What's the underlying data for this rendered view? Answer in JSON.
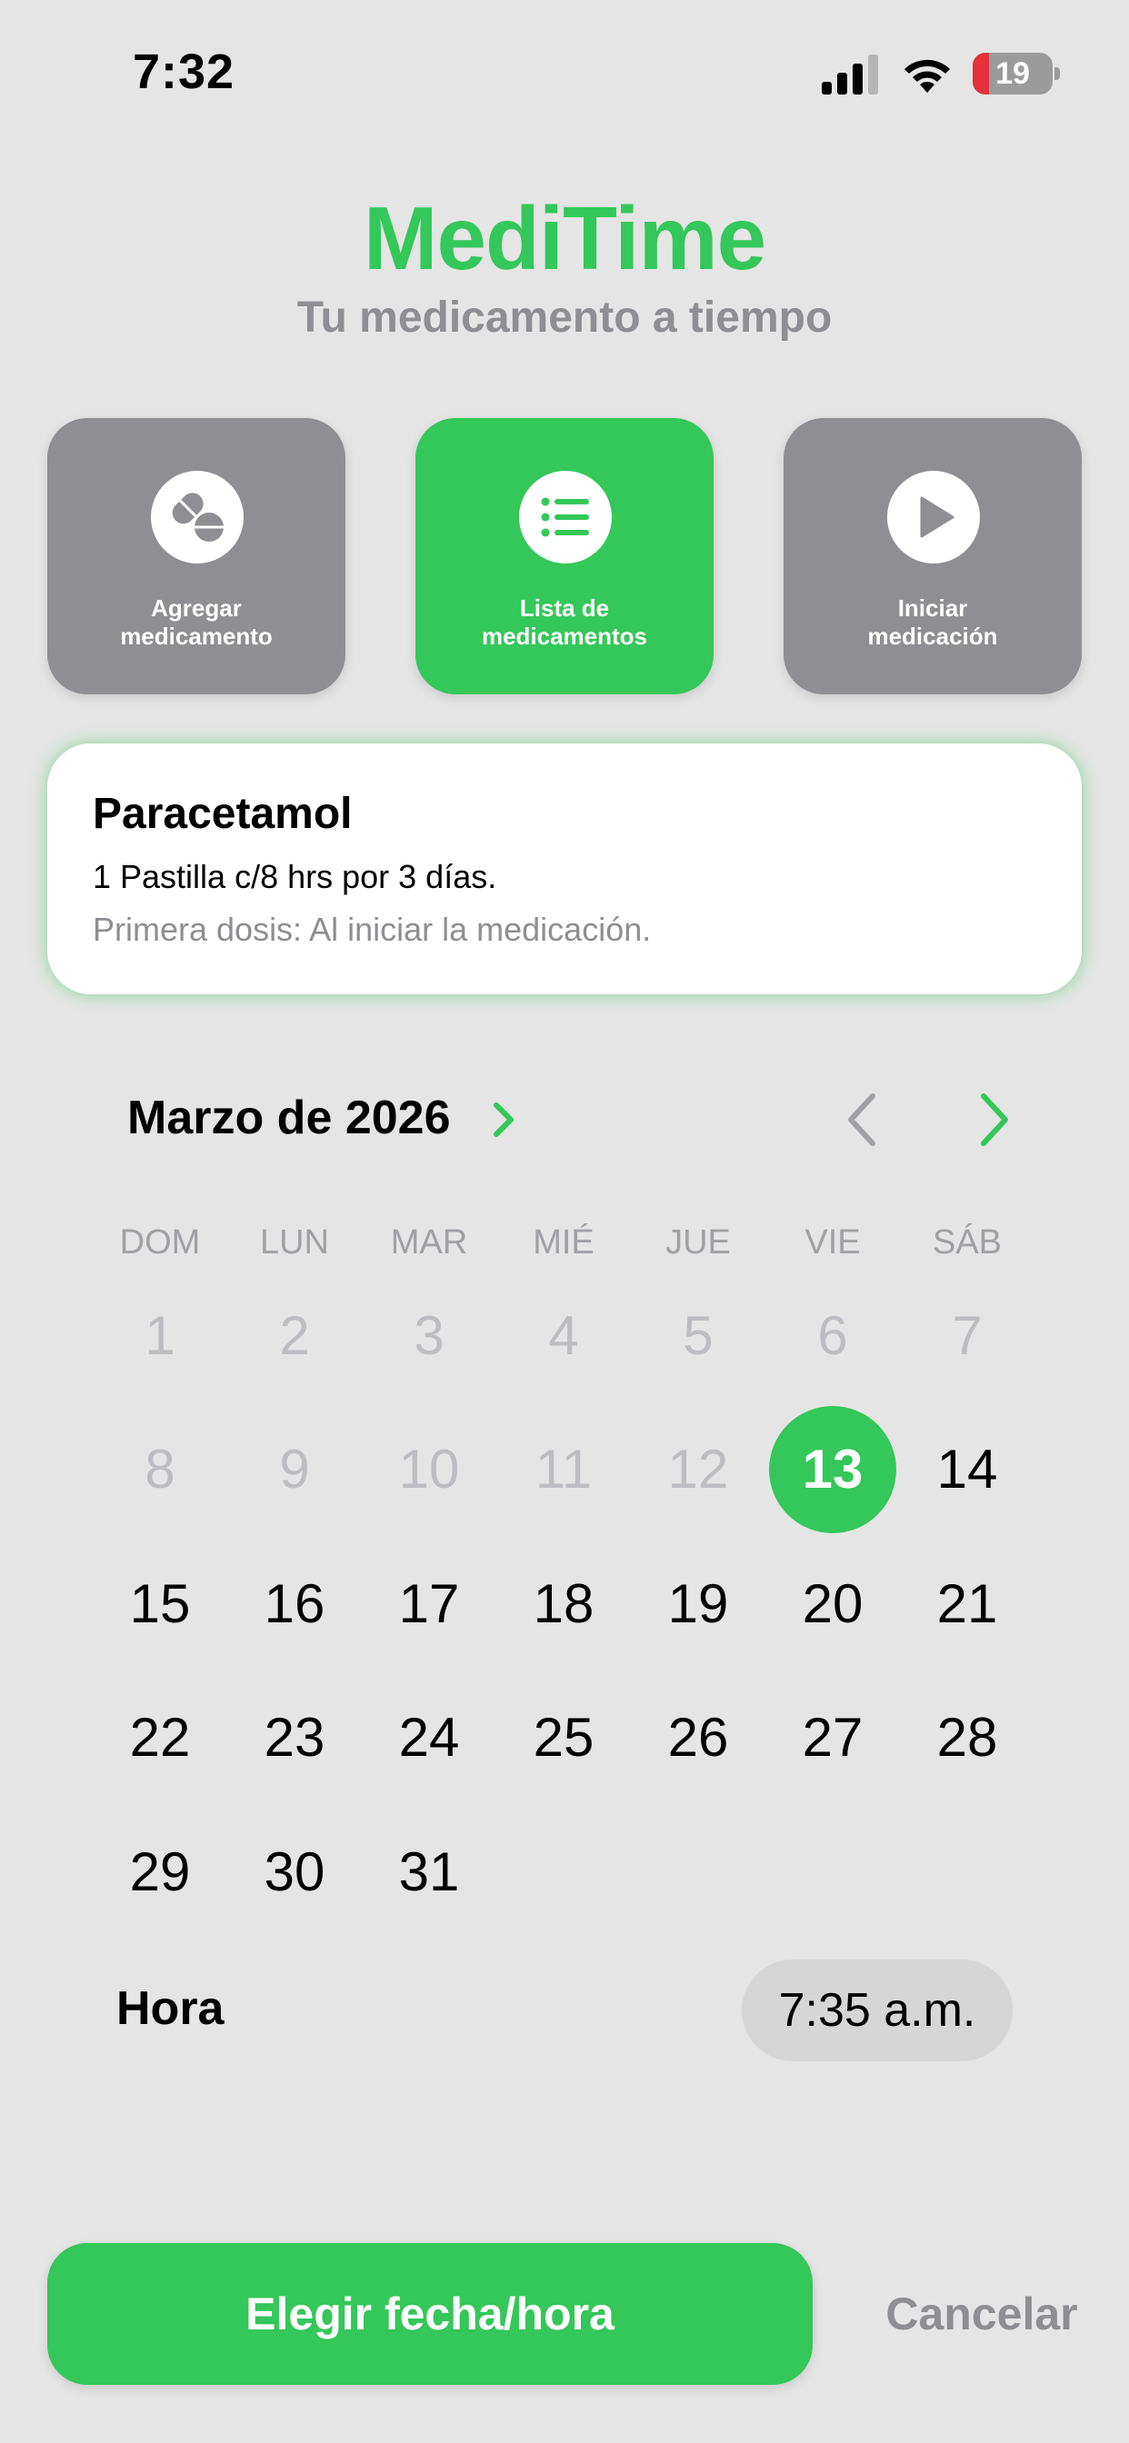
{
  "status": {
    "time": "7:32",
    "battery": "19"
  },
  "header": {
    "title": "MediTime",
    "subtitle": "Tu medicamento a tiempo"
  },
  "tiles": [
    {
      "label": "Agregar\nmedicamento",
      "icon": "pills-icon"
    },
    {
      "label": "Lista de\nmedicamentos",
      "icon": "list-icon"
    },
    {
      "label": "Iniciar\nmedicación",
      "icon": "play-icon"
    }
  ],
  "medication": {
    "name": "Paracetamol",
    "dose": "1 Pastilla c/8 hrs por 3 días.",
    "first_dose": "Primera dosis: Al iniciar la medicación."
  },
  "calendar": {
    "month_label": "Marzo de 2026",
    "weekdays": [
      "DOM",
      "LUN",
      "MAR",
      "MIÉ",
      "JUE",
      "VIE",
      "SÁB"
    ],
    "selected_day": "13",
    "days": [
      "1",
      "2",
      "3",
      "4",
      "5",
      "6",
      "7",
      "8",
      "9",
      "10",
      "11",
      "12",
      "13",
      "14",
      "15",
      "16",
      "17",
      "18",
      "19",
      "20",
      "21",
      "22",
      "23",
      "24",
      "25",
      "26",
      "27",
      "28",
      "29",
      "30",
      "31"
    ]
  },
  "time_picker": {
    "label": "Hora",
    "value": "7:35 a.m."
  },
  "actions": {
    "confirm": "Elegir fecha/hora",
    "cancel": "Cancelar"
  },
  "colors": {
    "accent": "#34c759",
    "tile_gray": "#8e8e93",
    "background": "#e5e5e5"
  }
}
